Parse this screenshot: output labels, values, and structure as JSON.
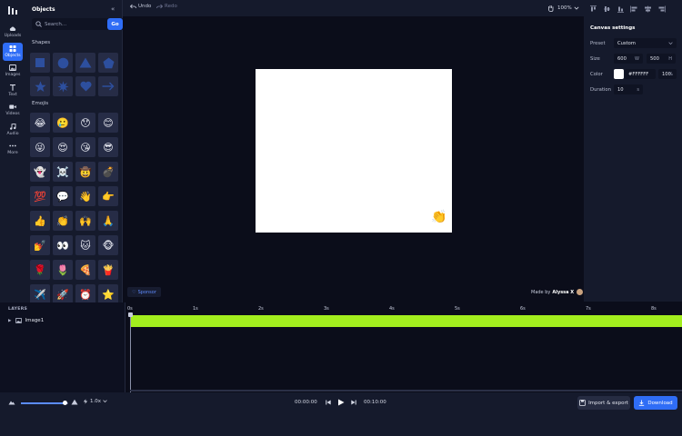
{
  "rail": {
    "items": [
      {
        "label": "Uploads",
        "icon": "cloud-upload-icon"
      },
      {
        "label": "Objects",
        "icon": "grid-icon",
        "active": true
      },
      {
        "label": "Images",
        "icon": "image-icon"
      },
      {
        "label": "Text",
        "icon": "text-icon"
      },
      {
        "label": "Videos",
        "icon": "video-icon"
      },
      {
        "label": "Audio",
        "icon": "music-icon"
      },
      {
        "label": "More",
        "icon": "more-icon"
      }
    ]
  },
  "objects_panel": {
    "title": "Objects",
    "search_placeholder": "Search...",
    "go_label": "Go",
    "shapes_label": "Shapes",
    "emojis_label": "Emojis",
    "shapes": [
      "square-icon",
      "circle-icon",
      "triangle-icon",
      "pentagon-icon",
      "star-icon",
      "burst-icon",
      "heart-icon",
      "arrow-right-icon"
    ],
    "emojis": [
      "😂",
      "🥲",
      "😯",
      "😊",
      "😜",
      "😍",
      "😘",
      "😎",
      "👻",
      "☠️",
      "🤠",
      "💣",
      "💯",
      "💬",
      "👋",
      "👉",
      "👍",
      "👏",
      "🙌",
      "🙏",
      "💅",
      "👀",
      "🐱",
      "🐵",
      "🌹",
      "🌷",
      "🍕",
      "🍟",
      "✈️",
      "🚀",
      "⏰",
      "⭐"
    ]
  },
  "toolbar": {
    "undo": "Undo",
    "redo": "Redo",
    "zoom": "100%"
  },
  "canvas": {
    "background": "#FFFFFF",
    "emoji": "👏"
  },
  "workspace": {
    "sponsor": "Sponsor",
    "made_by_prefix": "Made by",
    "made_by_name": "Alyssa X"
  },
  "canvas_settings": {
    "title": "Canvas settings",
    "preset_label": "Preset",
    "preset_value": "Custom",
    "size_label": "Size",
    "width": "600",
    "width_unit": "W",
    "height": "500",
    "height_unit": "H",
    "color_label": "Color",
    "color_value": "#FFFFFF",
    "opacity": "100",
    "opacity_unit": "%",
    "duration_label": "Duration",
    "duration": "10",
    "duration_unit": "s"
  },
  "layers": {
    "title": "LAYERS",
    "items": [
      {
        "name": "Image1"
      }
    ]
  },
  "timeline": {
    "ticks": [
      "0s",
      "1s",
      "2s",
      "3s",
      "4s",
      "5s",
      "6s",
      "7s",
      "8s"
    ],
    "track_color": "#A3EE1E"
  },
  "bottom": {
    "speed": "1.0x",
    "current_time": "00:00:00",
    "total_time": "00:10:00",
    "import_export": "Import & export",
    "download": "Download"
  }
}
